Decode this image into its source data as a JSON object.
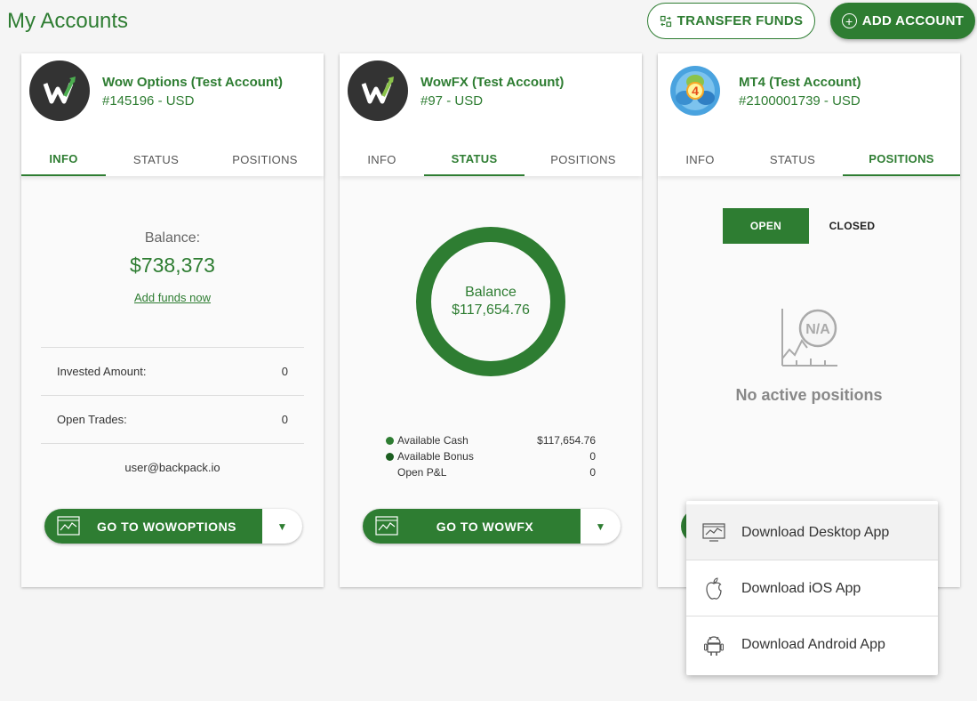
{
  "header": {
    "title": "My Accounts",
    "transfer_label": "TRANSFER FUNDS",
    "add_account_label": "ADD ACCOUNT"
  },
  "colors": {
    "accent": "#2e7d32",
    "dark_green": "#1b5e20"
  },
  "accounts": [
    {
      "name": "Wow Options (Test Account)",
      "number": "#145196 - USD",
      "tabs": [
        "INFO",
        "STATUS",
        "POSITIONS"
      ],
      "active_tab": "INFO",
      "info": {
        "balance_label": "Balance:",
        "balance_value": "$738,373",
        "add_funds": "Add funds now",
        "rows": [
          {
            "label": "Invested Amount:",
            "value": "0"
          },
          {
            "label": "Open Trades:",
            "value": "0"
          }
        ],
        "email": "user@backpack.io"
      },
      "goto_label": "GO TO WOWOPTIONS"
    },
    {
      "name": "WowFX (Test Account)",
      "number": "#97 - USD",
      "tabs": [
        "INFO",
        "STATUS",
        "POSITIONS"
      ],
      "active_tab": "STATUS",
      "status": {
        "ring_label": "Balance",
        "ring_value": "$117,654.76",
        "legend": [
          {
            "label": "Available Cash",
            "value": "$117,654.76",
            "color": "#2e7d32"
          },
          {
            "label": "Available Bonus",
            "value": "0",
            "color": "#1b5e20"
          },
          {
            "label": "Open P&L",
            "value": "0",
            "color": ""
          }
        ]
      },
      "goto_label": "GO TO WOWFX"
    },
    {
      "name": "MT4 (Test Account)",
      "number": "#2100001739 - USD",
      "tabs": [
        "INFO",
        "STATUS",
        "POSITIONS"
      ],
      "active_tab": "POSITIONS",
      "positions": {
        "open_label": "OPEN",
        "closed_label": "CLOSED",
        "na_text": "N/A",
        "empty_text": "No active positions"
      },
      "mt4_logo_text": "4"
    }
  ],
  "download_menu": {
    "items": [
      {
        "label": "Download Desktop App",
        "icon": "desktop-chart-icon"
      },
      {
        "label": "Download iOS App",
        "icon": "apple-icon"
      },
      {
        "label": "Download Android App",
        "icon": "android-icon"
      }
    ]
  }
}
